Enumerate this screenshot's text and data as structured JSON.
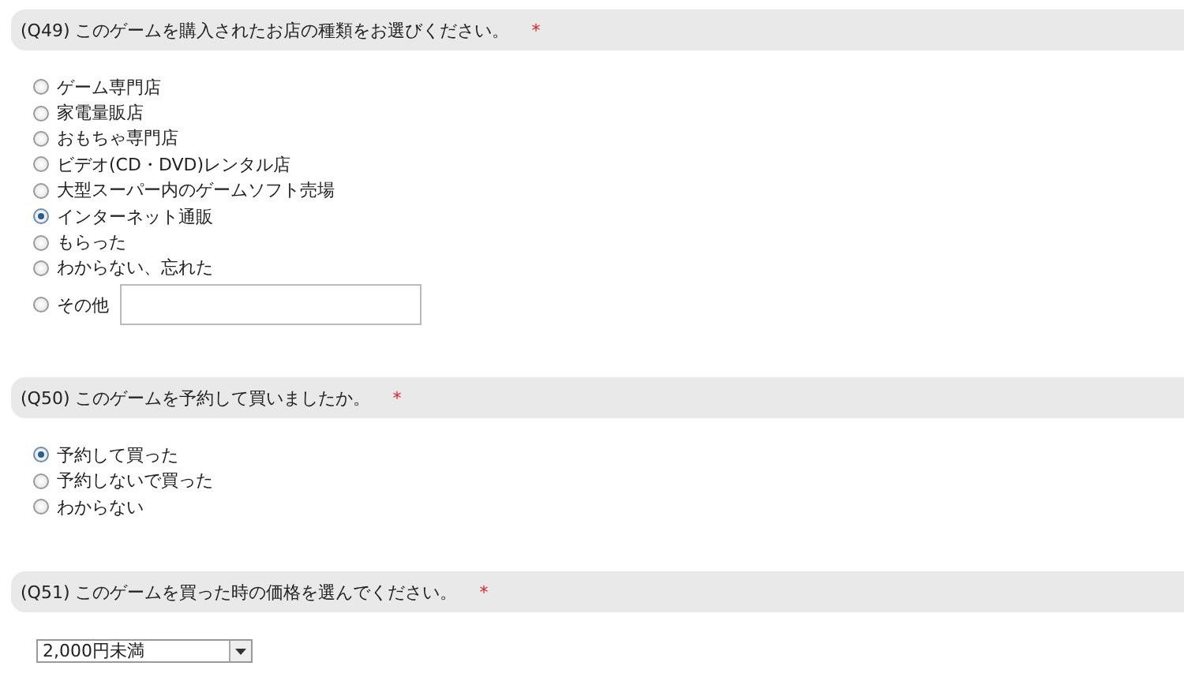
{
  "questions": [
    {
      "kind": "radio",
      "number": "(Q49)",
      "title": "このゲームを購入されたお店の種類をお選びください。",
      "required_mark": "*",
      "options": [
        {
          "label": "ゲーム専門店",
          "selected": false,
          "kind": "plain"
        },
        {
          "label": "家電量販店",
          "selected": false,
          "kind": "plain"
        },
        {
          "label": "おもちゃ専門店",
          "selected": false,
          "kind": "plain"
        },
        {
          "label": "ビデオ(CD・DVD)レンタル店",
          "selected": false,
          "kind": "plain"
        },
        {
          "label": "大型スーパー内のゲームソフト売場",
          "selected": false,
          "kind": "plain"
        },
        {
          "label": "インターネット通販",
          "selected": true,
          "kind": "plain"
        },
        {
          "label": "もらった",
          "selected": false,
          "kind": "plain"
        },
        {
          "label": "わからない、忘れた",
          "selected": false,
          "kind": "plain"
        },
        {
          "label": "その他",
          "selected": false,
          "kind": "other"
        }
      ]
    },
    {
      "kind": "radio",
      "number": "(Q50)",
      "title": "このゲームを予約して買いましたか。",
      "required_mark": "*",
      "options": [
        {
          "label": "予約して買った",
          "selected": true,
          "kind": "plain"
        },
        {
          "label": "予約しないで買った",
          "selected": false,
          "kind": "plain"
        },
        {
          "label": "わからない",
          "selected": false,
          "kind": "plain"
        }
      ]
    },
    {
      "kind": "select",
      "number": "(Q51)",
      "title": "このゲームを買った時の価格を選んでください。",
      "required_mark": "*",
      "value": "2,000円未満"
    }
  ]
}
